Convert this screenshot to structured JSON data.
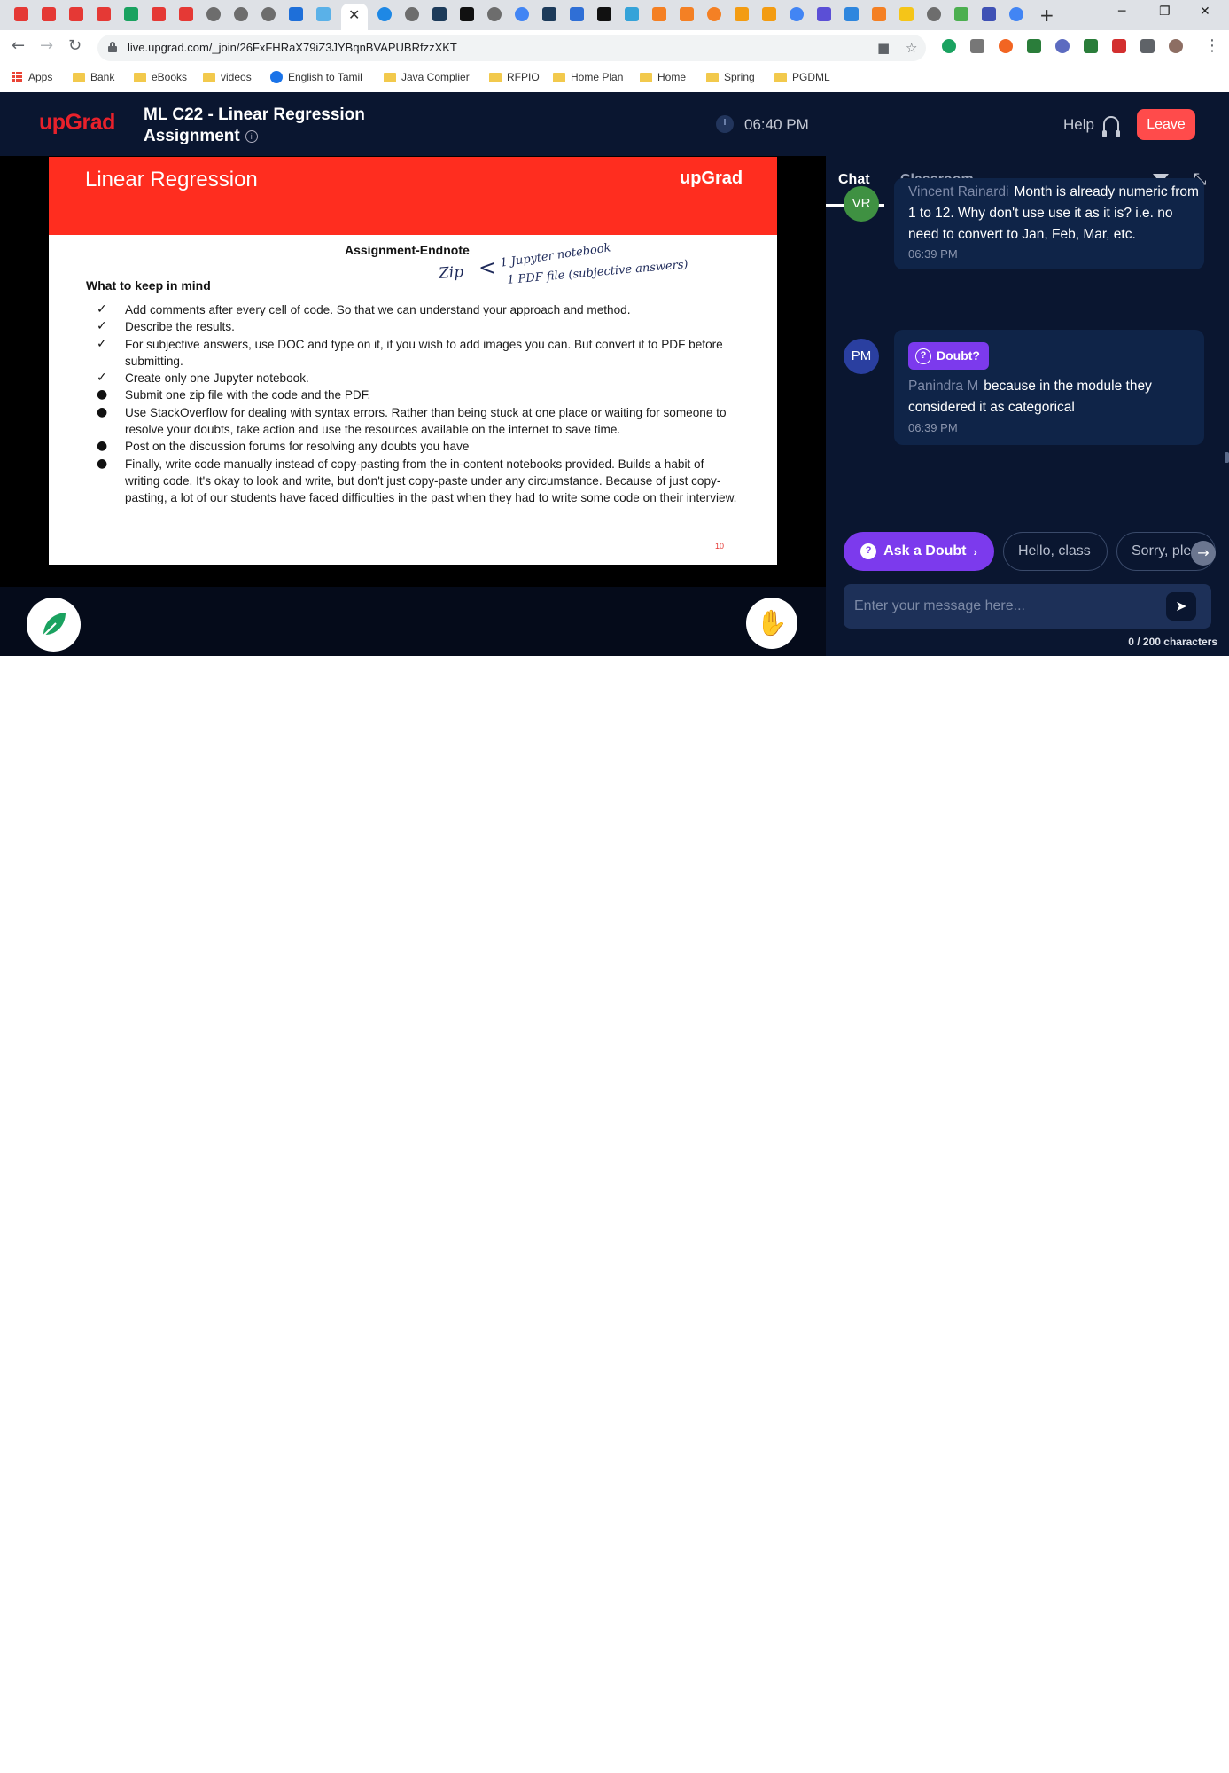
{
  "browser": {
    "url": "live.upgrad.com/_join/26FxFHRaX79iZ3JYBqnBVAPUBRfzzXKT",
    "bookmarks": [
      "Apps",
      "Bank",
      "eBooks",
      "videos",
      "English to Tamil",
      "Java Complier",
      "RFPIO",
      "Home Plan",
      "Home",
      "Spring",
      "PGDML"
    ]
  },
  "header": {
    "logo": "upGrad",
    "title": "ML C22 - Linear Regression Assignment",
    "time": "06:40 PM",
    "help_label": "Help",
    "leave_label": "Leave"
  },
  "slide": {
    "title": "Linear Regression",
    "logo": "upGrad",
    "subtitle": "Assignment-Endnote",
    "section": "What to keep in mind",
    "items": [
      "Add comments after every cell of code. So that we can understand your approach and method.",
      "Describe the results.",
      "For subjective answers, use DOC and type on it, if you wish to add images you can. But convert it to PDF before submitting.",
      "Create only one Jupyter notebook.",
      "Submit one zip file with the code and the PDF.",
      "Use StackOverflow for dealing with syntax errors. Rather than being stuck at one place or waiting for someone to resolve your doubts, take action and use the resources available on the internet to save time.",
      "Post on the discussion forums for resolving any doubts you have",
      "Finally, write code manually instead of copy-pasting from the in-content notebooks provided. Builds a habit of writing code. It's okay to look and write, but don't just copy-paste under any circumstance. Because of just copy-pasting, a lot of our students have faced difficulties in the past when they had to write some code on their interview."
    ],
    "annotations": {
      "zip": "Zip",
      "line1": "1 Jupyter notebook",
      "line2": "1 PDF file (subjective answers)"
    },
    "page_number": "10"
  },
  "chat": {
    "tabs": [
      "Chat",
      "Classroom"
    ],
    "messages": [
      {
        "initials": "VR",
        "author": "Vincent Rainardi",
        "text": "Month is already numeric from 1 to 12. Why don't use use it as it is? i.e. no need to convert to Jan, Feb, Mar, etc.",
        "time": "06:39 PM",
        "avatar_color": "#3f9142"
      },
      {
        "initials": "PM",
        "author": "Panindra M",
        "badge": "Doubt?",
        "text": "because in the module they considered it as categorical",
        "time": "06:39 PM",
        "avatar_color": "#2a3fa0"
      }
    ],
    "ask_doubt_label": "Ask a Doubt",
    "quick_replies": [
      "Hello, class",
      "Sorry, ple"
    ],
    "input_placeholder": "Enter your message here...",
    "char_count": "0 / 200 characters"
  },
  "colors": {
    "brand_red": "#e8212b",
    "leave_red": "#ff4b4b",
    "accent_purple": "#7c3aed",
    "panel_bg": "#0a1630"
  }
}
